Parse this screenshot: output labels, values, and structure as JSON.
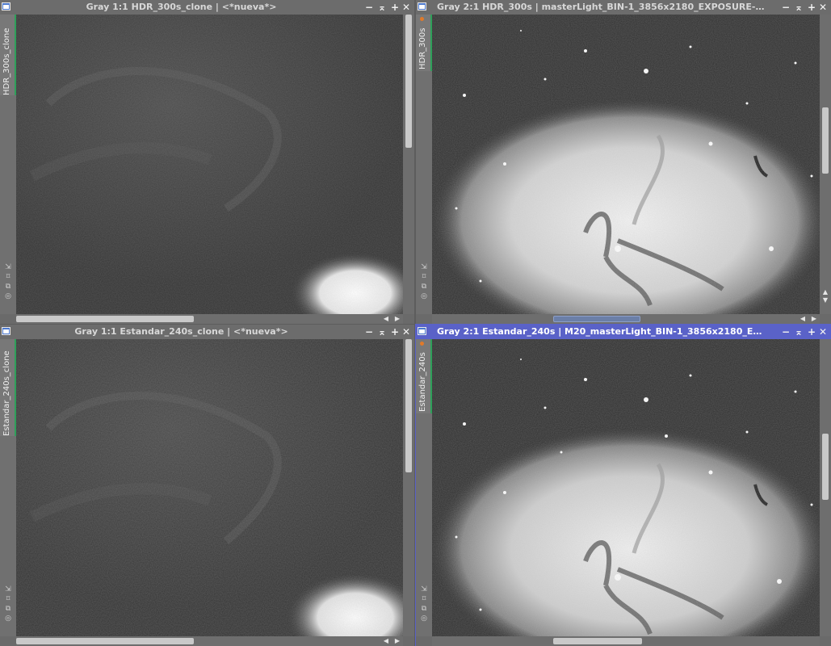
{
  "windows": [
    {
      "id": "hdr-clone",
      "title": "Gray 1:1 HDR_300s_clone | <*nueva*>",
      "tab_label": "HDR_300s_clone",
      "zoom": "1:1",
      "active": false
    },
    {
      "id": "hdr",
      "title": "Gray 2:1 HDR_300s | masterLight_BIN-1_3856x2180_EXPOSURE-30...",
      "tab_label": "HDR_300s",
      "zoom": "2:1",
      "active": false
    },
    {
      "id": "std-clone",
      "title": "Gray 1:1 Estandar_240s_clone | <*nueva*>",
      "tab_label": "Estandar_240s_clone",
      "zoom": "1:1",
      "active": false
    },
    {
      "id": "std",
      "title": "Gray 2:1 Estandar_240s | M20_masterLight_BIN-1_3856x2180_EXP...",
      "tab_label": "Estandar_240s",
      "zoom": "2:1",
      "active": true
    }
  ],
  "controls": {
    "minimize": "−",
    "shade": "⌅",
    "maximize": "+",
    "close": "✕"
  },
  "side_icons": [
    "⇲",
    "⌑",
    "⧉",
    "◎"
  ],
  "colors": {
    "active_title": "#5a62c8",
    "inactive_title": "#6c6c6c",
    "tab_marker": "#2ea05a"
  }
}
